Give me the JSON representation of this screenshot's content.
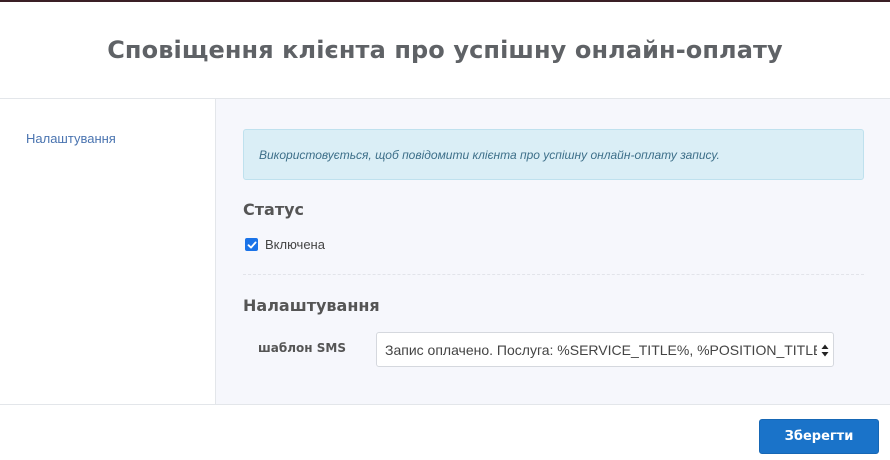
{
  "modal": {
    "title": "Сповіщення клієнта про успішну онлайн-оплату"
  },
  "sidebar": {
    "items": [
      {
        "label": "Налаштування"
      }
    ]
  },
  "content": {
    "info": "Використовується, щоб повідомити клієнта про успішну онлайн-оплату запису.",
    "status": {
      "title": "Статус",
      "checkbox_label": "Включена",
      "checked": true
    },
    "settings": {
      "title": "Налаштування",
      "sms_template_label": "шаблон SMS",
      "sms_template_value": "Запис оплачено. Послуга: %SERVICE_TITLE%, %POSITION_TITLE%: %"
    }
  },
  "footer": {
    "save_label": "Зберегти"
  },
  "colors": {
    "accent": "#1a73c9",
    "info_bg": "#daeef6",
    "content_bg": "#f6f7fc",
    "link": "#4a74b0"
  },
  "icons": {
    "checkbox": "check-icon",
    "select": "select-arrows-icon"
  }
}
